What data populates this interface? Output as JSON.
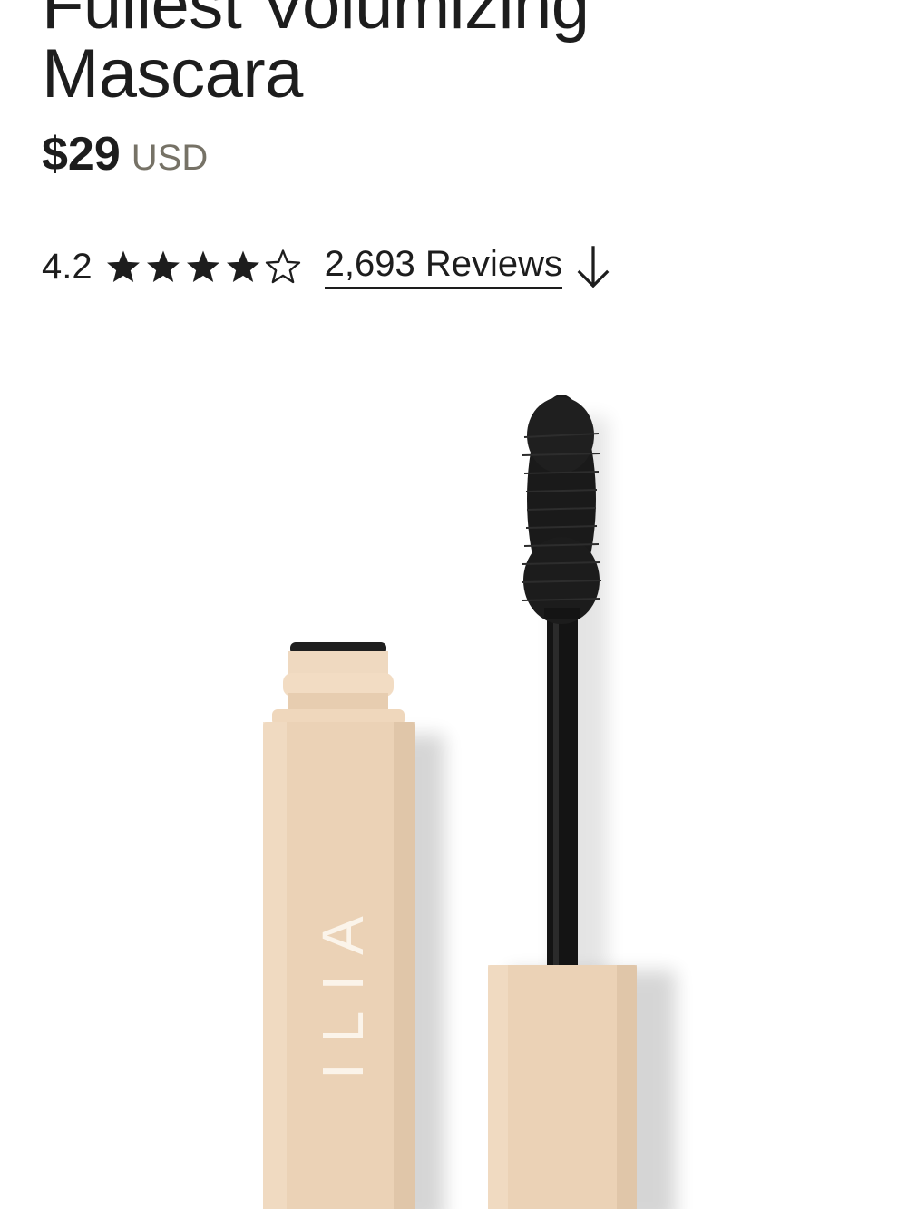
{
  "product": {
    "title_line_1": "Fullest Volumizing",
    "title_line_2": "Mascara",
    "price": "$29",
    "currency": "USD"
  },
  "rating": {
    "value": "4.2",
    "score": 4.2,
    "max": 5,
    "reviews_link": "2,693 Reviews"
  },
  "image": {
    "brand_print": "ILIA"
  },
  "colors": {
    "text": "#1d1d1d",
    "muted": "#767266",
    "tube": "#ebd2b6"
  },
  "icons": {
    "filled_star": "star-filled-icon",
    "empty_star": "star-outline-icon",
    "reviews_arrow": "arrow-down-icon"
  }
}
